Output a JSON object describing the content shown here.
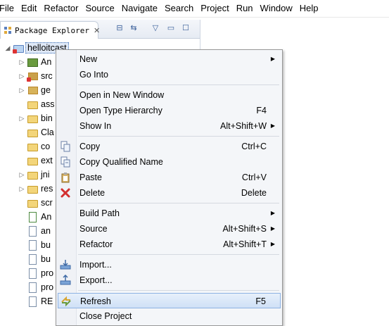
{
  "menubar": {
    "items": [
      "File",
      "Edit",
      "Refactor",
      "Source",
      "Navigate",
      "Search",
      "Project",
      "Run",
      "Window",
      "Help"
    ]
  },
  "explorer": {
    "tab_label": "Package Explorer",
    "tab_close": "✕",
    "tools": {
      "collapse": "⊟",
      "link": "⇆",
      "menu": "▽",
      "minimize": "▭",
      "maximize": "☐"
    },
    "tree": {
      "root": {
        "label": "helloitcast",
        "expanded": true
      },
      "children": [
        {
          "label": "An",
          "icon": "android-library-icon",
          "twisty": "▷"
        },
        {
          "label": "src",
          "icon": "source-folder-error-icon",
          "twisty": "▷"
        },
        {
          "label": "ge",
          "icon": "gen-folder-icon",
          "twisty": "▷"
        },
        {
          "label": "ass",
          "icon": "folder-icon",
          "twisty": ""
        },
        {
          "label": "bin",
          "icon": "folder-icon",
          "twisty": "▷"
        },
        {
          "label": "Cla",
          "icon": "package-icon",
          "twisty": ""
        },
        {
          "label": "co",
          "icon": "package-icon",
          "twisty": ""
        },
        {
          "label": "ext",
          "icon": "package-icon",
          "twisty": ""
        },
        {
          "label": "jni",
          "icon": "folder-icon",
          "twisty": "▷"
        },
        {
          "label": "res",
          "icon": "folder-icon",
          "twisty": "▷"
        },
        {
          "label": "scr",
          "icon": "package-icon",
          "twisty": ""
        },
        {
          "label": "An",
          "icon": "xml-file-icon",
          "twisty": ""
        },
        {
          "label": "an",
          "icon": "file-icon",
          "twisty": ""
        },
        {
          "label": "bu",
          "icon": "file-icon",
          "twisty": ""
        },
        {
          "label": "bu",
          "icon": "file-icon",
          "twisty": ""
        },
        {
          "label": "pro",
          "icon": "file-icon",
          "twisty": ""
        },
        {
          "label": "pro",
          "icon": "file-icon",
          "twisty": ""
        },
        {
          "label": "RE",
          "icon": "file-icon",
          "twisty": ""
        }
      ]
    }
  },
  "context_menu": {
    "items": [
      {
        "label": "New",
        "shortcut": "",
        "submenu": true,
        "icon": ""
      },
      {
        "label": "Go Into",
        "shortcut": "",
        "submenu": false,
        "icon": ""
      },
      {
        "separator": true
      },
      {
        "label": "Open in New Window",
        "shortcut": "",
        "submenu": false,
        "icon": ""
      },
      {
        "label": "Open Type Hierarchy",
        "shortcut": "F4",
        "submenu": false,
        "icon": ""
      },
      {
        "label": "Show In",
        "shortcut": "Alt+Shift+W",
        "submenu": true,
        "icon": ""
      },
      {
        "separator": true
      },
      {
        "label": "Copy",
        "shortcut": "Ctrl+C",
        "submenu": false,
        "icon": "copy-icon"
      },
      {
        "label": "Copy Qualified Name",
        "shortcut": "",
        "submenu": false,
        "icon": "copy-qualified-icon"
      },
      {
        "label": "Paste",
        "shortcut": "Ctrl+V",
        "submenu": false,
        "icon": "paste-icon"
      },
      {
        "label": "Delete",
        "shortcut": "Delete",
        "submenu": false,
        "icon": "delete-icon"
      },
      {
        "separator": true
      },
      {
        "label": "Build Path",
        "shortcut": "",
        "submenu": true,
        "icon": ""
      },
      {
        "label": "Source",
        "shortcut": "Alt+Shift+S",
        "submenu": true,
        "icon": ""
      },
      {
        "label": "Refactor",
        "shortcut": "Alt+Shift+T",
        "submenu": true,
        "icon": ""
      },
      {
        "separator": true
      },
      {
        "label": "Import...",
        "shortcut": "",
        "submenu": false,
        "icon": "import-icon"
      },
      {
        "label": "Export...",
        "shortcut": "",
        "submenu": false,
        "icon": "export-icon"
      },
      {
        "separator": true
      },
      {
        "label": "Refresh",
        "shortcut": "F5",
        "submenu": false,
        "icon": "refresh-icon",
        "highlighted": true
      },
      {
        "label": "Close Project",
        "shortcut": "",
        "submenu": false,
        "icon": ""
      }
    ]
  },
  "colors": {
    "menu_bg": "#f4f6f9",
    "highlight": "#cfe0f6",
    "delete_red": "#d32f2f"
  }
}
